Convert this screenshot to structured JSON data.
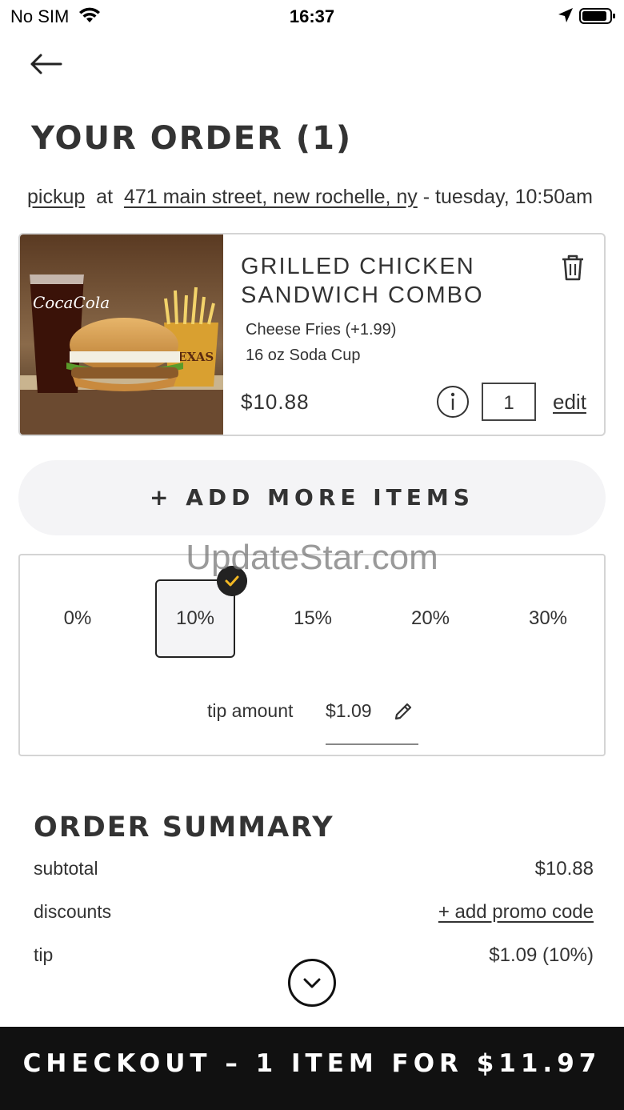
{
  "status_bar": {
    "carrier": "No SIM",
    "time": "16:37",
    "icons": [
      "wifi-icon",
      "location-arrow-icon",
      "battery-icon"
    ]
  },
  "header": {
    "back_icon": "arrow-left-icon",
    "title": "YOUR ORDER (1)"
  },
  "pickup": {
    "mode": "pickup",
    "at": "at",
    "address": "471 main street, new rochelle, ny",
    "time": "- tuesday, 10:50am"
  },
  "cart": {
    "items": [
      {
        "name": "GRILLED CHICKEN SANDWICH COMBO",
        "modifiers": [
          "Cheese Fries (+1.99)",
          "16 oz Soda Cup"
        ],
        "price": "$10.88",
        "quantity": "1",
        "edit_label": "edit",
        "icons": [
          "trash-icon",
          "info-icon"
        ]
      }
    ]
  },
  "add_more_label": "+ ADD MORE ITEMS",
  "watermark": "UpdateStar.com",
  "tip": {
    "options": [
      "0%",
      "10%",
      "15%",
      "20%",
      "30%"
    ],
    "selected": "10%",
    "amount_label": "tip amount",
    "amount_value": "$1.09"
  },
  "summary": {
    "title": "ORDER SUMMARY",
    "subtotal_label": "subtotal",
    "subtotal_value": "$10.88",
    "discounts_label": "discounts",
    "promo_label": "+ add promo code",
    "tip_label": "tip",
    "tip_value": "$1.09 (10%)"
  },
  "checkout": {
    "label": "CHECKOUT – 1 ITEM FOR $11.97"
  },
  "colors": {
    "text": "#333333",
    "checkout_bg": "#111111",
    "pill_bg": "#f4f4f6",
    "check_badge": "#222222",
    "check_mark": "#f2b824",
    "border": "#d4d4d4"
  }
}
